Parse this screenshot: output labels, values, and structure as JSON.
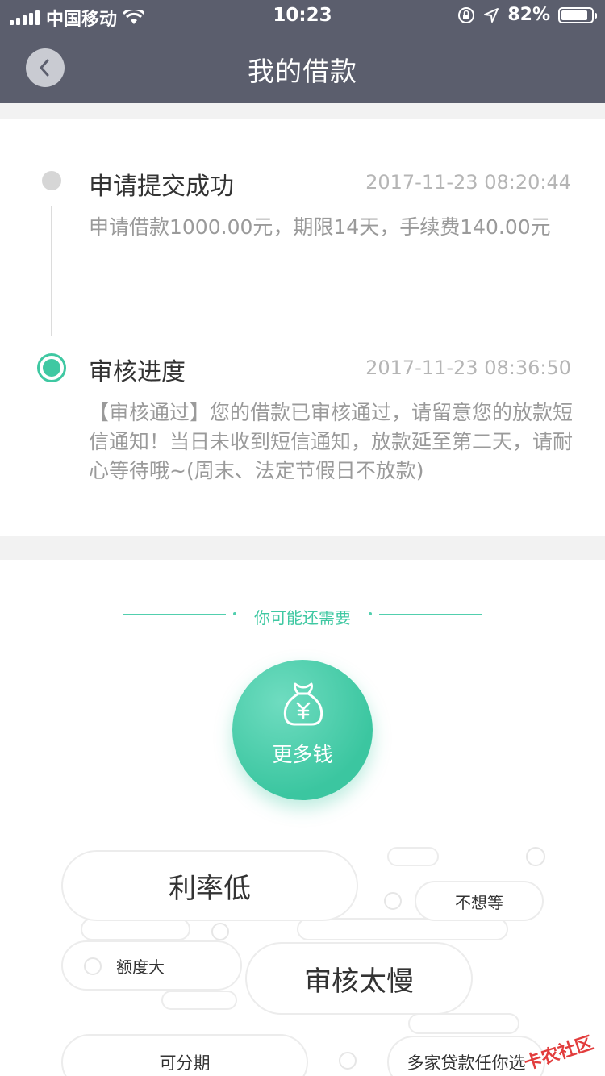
{
  "status_bar": {
    "carrier": "中国移动",
    "time": "10:23",
    "battery": "82%"
  },
  "nav": {
    "title": "我的借款"
  },
  "timeline": [
    {
      "title": "申请提交成功",
      "time": "2017-11-23 08:20:44",
      "desc": "申请借款1000.00元，期限14天，手续费140.00元"
    },
    {
      "title": "审核进度",
      "time": "2017-11-23 08:36:50",
      "desc": "【审核通过】您的借款已审核通过，请留意您的放款短信通知！当日未收到短信通知，放款延至第二天，请耐心等待哦~(周末、法定节假日不放款)"
    }
  ],
  "suggestion": {
    "heading": "你可能还需要",
    "more_money_label": "更多钱",
    "tags": [
      "利率低",
      "不想等",
      "额度大",
      "审核太慢",
      "可分期",
      "多家贷款任你选"
    ]
  },
  "watermark": "卡农社区",
  "colors": {
    "header": "#5b5e6d",
    "accent": "#3fc8a2"
  }
}
